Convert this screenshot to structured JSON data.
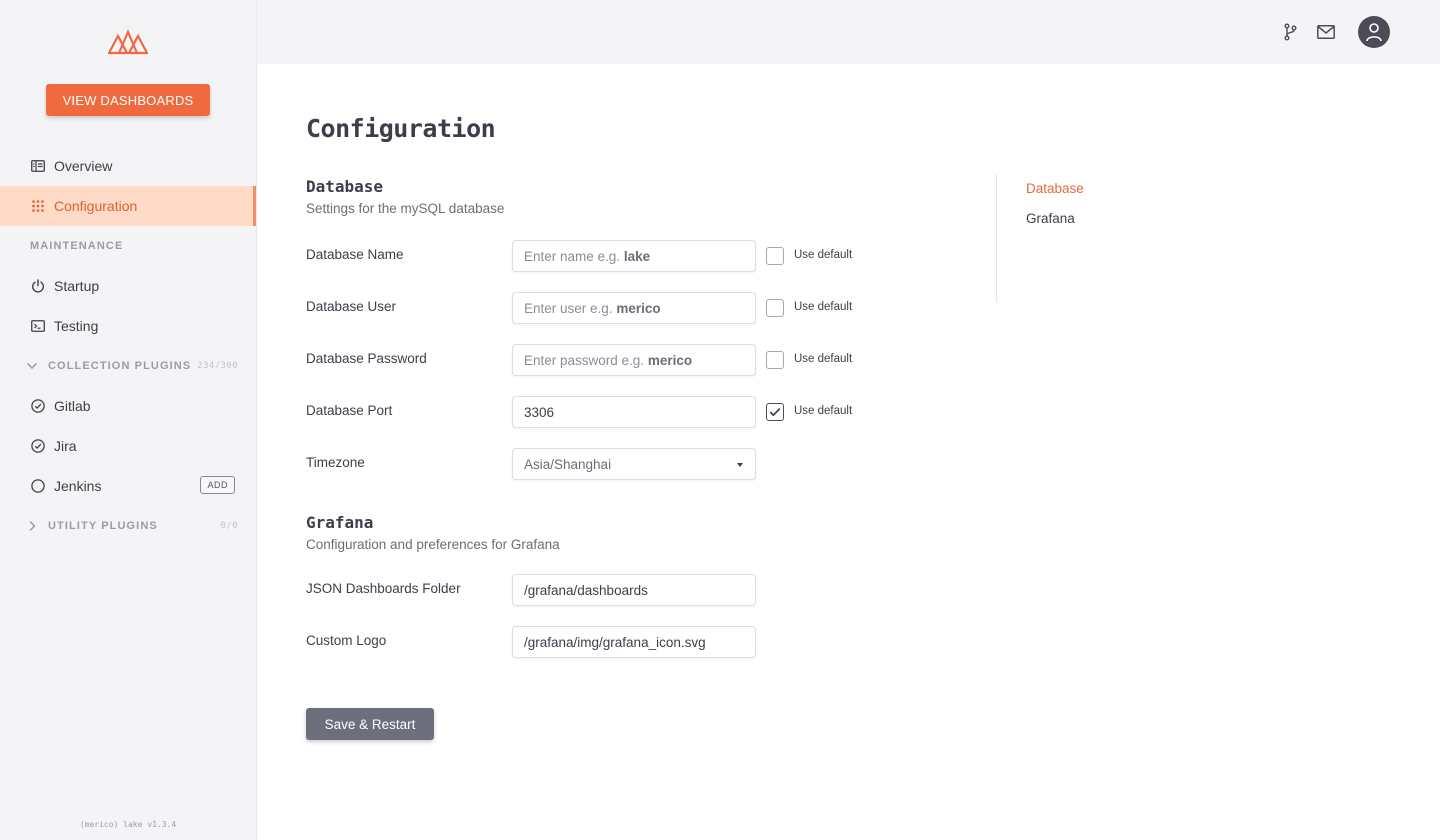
{
  "sidebar": {
    "view_dashboards": "VIEW DASHBOARDS",
    "nav": {
      "overview": "Overview",
      "configuration": "Configuration"
    },
    "maintenance_label": "MAINTENANCE",
    "maintenance": {
      "startup": "Startup",
      "testing": "Testing"
    },
    "collection_plugins": {
      "label": "COLLECTION PLUGINS",
      "count": "234/300",
      "items": {
        "gitlab": "Gitlab",
        "jira": "Jira",
        "jenkins": "Jenkins",
        "jenkins_badge": "ADD"
      }
    },
    "utility_plugins": {
      "label": "UTILITY PLUGINS",
      "count": "0/0"
    },
    "version": "(merico) lake v1.3.4"
  },
  "page": {
    "title": "Configuration",
    "database": {
      "title": "Database",
      "description": "Settings for the mySQL database",
      "fields": {
        "name": {
          "label": "Database Name",
          "placeholder_prefix": "Enter name e.g. ",
          "placeholder_example": "lake",
          "use_default": false
        },
        "user": {
          "label": "Database User",
          "placeholder_prefix": "Enter user e.g. ",
          "placeholder_example": "merico",
          "use_default": false
        },
        "password": {
          "label": "Database Password",
          "placeholder_prefix": "Enter password e.g. ",
          "placeholder_example": "merico",
          "use_default": false
        },
        "port": {
          "label": "Database Port",
          "value": "3306",
          "use_default": true
        },
        "timezone": {
          "label": "Timezone",
          "value": "Asia/Shanghai"
        }
      },
      "use_default_label": "Use default"
    },
    "grafana": {
      "title": "Grafana",
      "description": "Configuration and preferences for Grafana",
      "fields": {
        "dashboards_folder": {
          "label": "JSON Dashboards Folder",
          "value": "/grafana/dashboards"
        },
        "custom_logo": {
          "label": "Custom Logo",
          "value": "/grafana/img/grafana_icon.svg"
        }
      }
    },
    "save_button": "Save & Restart"
  },
  "toc": {
    "database": "Database",
    "grafana": "Grafana"
  },
  "colors": {
    "accent": "#ef6a3f",
    "active_bg": "#fedbc6",
    "sidebar_bg": "#f4f4f7",
    "save_button_bg": "#6e6f7d"
  },
  "icons": {
    "logo": "merico-mountain-logo",
    "overview": "dashboard-icon",
    "configuration": "grid-dots-icon",
    "startup": "power-icon",
    "testing": "console-icon",
    "gitlab": "check-circle-icon",
    "jira": "check-circle-icon",
    "jenkins": "empty-circle-icon",
    "topbar": [
      "git-branch-icon",
      "mail-icon",
      "user-avatar-icon"
    ]
  }
}
